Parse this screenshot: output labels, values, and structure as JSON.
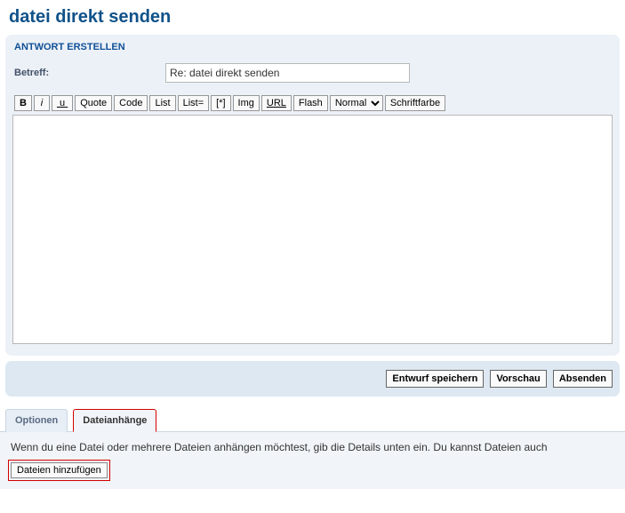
{
  "page": {
    "title": "datei direkt senden"
  },
  "compose": {
    "panel_header": "ANTWORT ERSTELLEN",
    "subject_label": "Betreff:",
    "subject_value": "Re: datei direkt senden"
  },
  "toolbar": {
    "bold": "B",
    "italic": "i",
    "underline": "u",
    "quote": "Quote",
    "code": "Code",
    "list": "List",
    "list_eq": "List=",
    "list_item": "[*]",
    "img": "Img",
    "url": "URL",
    "flash": "Flash",
    "font_size_selected": "Normal",
    "font_color": "Schriftfarbe"
  },
  "actions": {
    "save_draft": "Entwurf speichern",
    "preview": "Vorschau",
    "submit": "Absenden"
  },
  "tabs": {
    "options": "Optionen",
    "attachments": "Dateianhänge"
  },
  "attachments_panel": {
    "intro": "Wenn du eine Datei oder mehrere Dateien anhängen möchtest, gib die Details unten ein. Du kannst Dateien auch",
    "add_files": "Dateien hinzufügen"
  }
}
